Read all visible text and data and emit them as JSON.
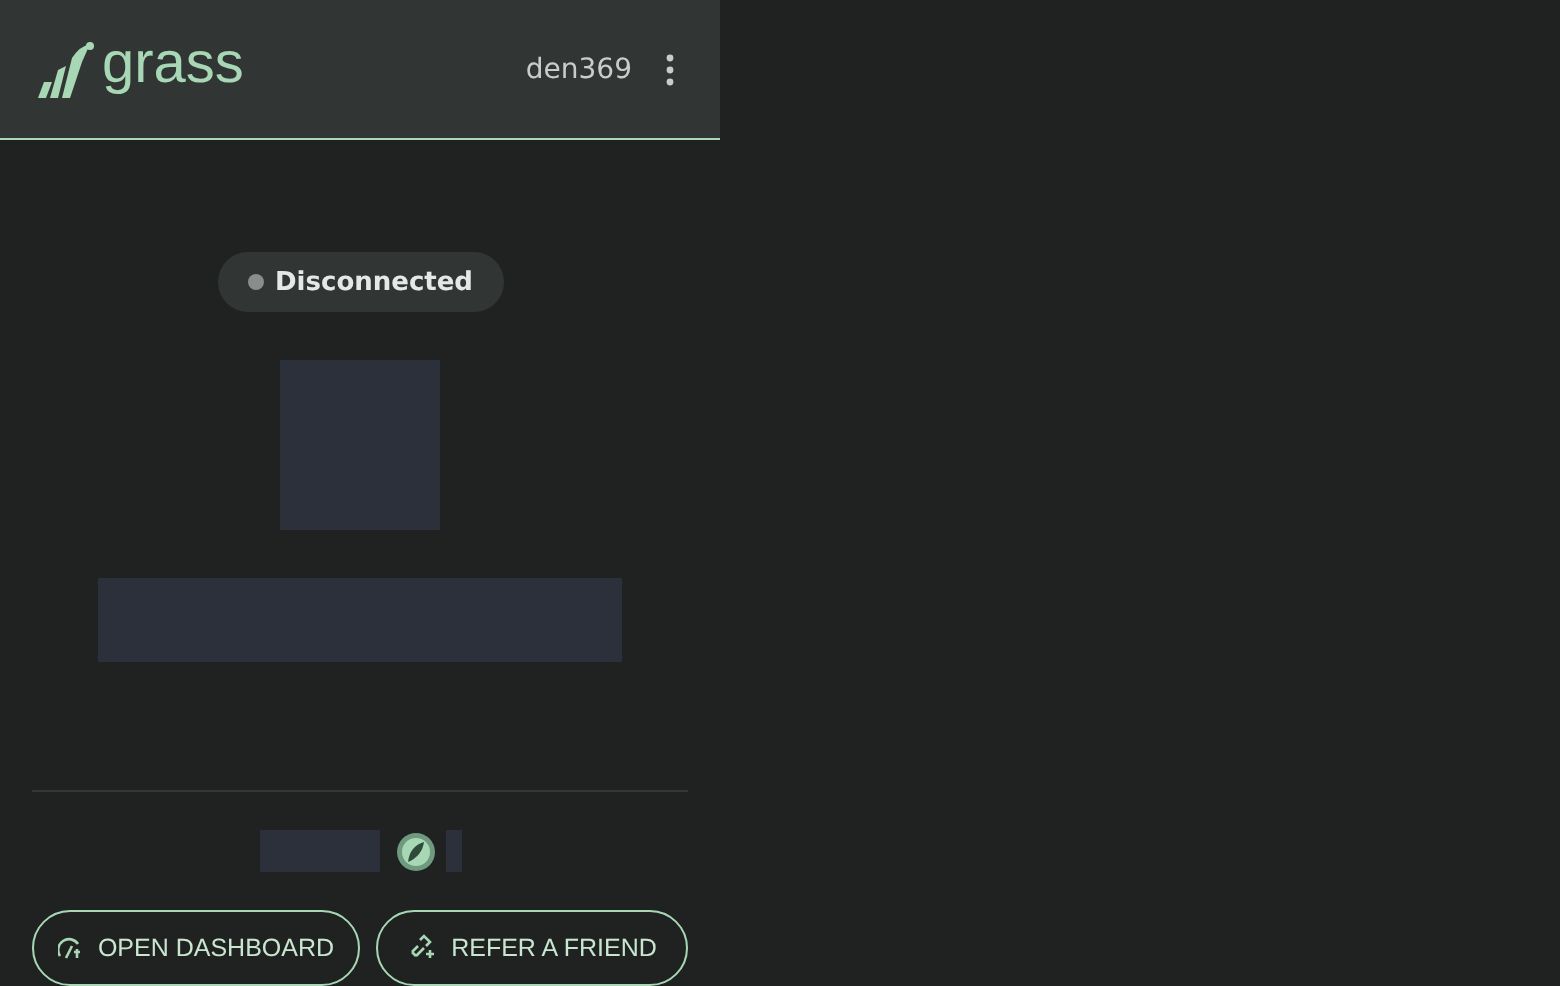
{
  "header": {
    "logo_text": "grass",
    "username": "den369"
  },
  "status": {
    "label": "Disconnected",
    "connected": false
  },
  "buttons": [
    {
      "label": "OPEN DASHBOARD",
      "kind": "dashboard"
    },
    {
      "label": "REFER A FRIEND",
      "kind": "refer"
    }
  ]
}
